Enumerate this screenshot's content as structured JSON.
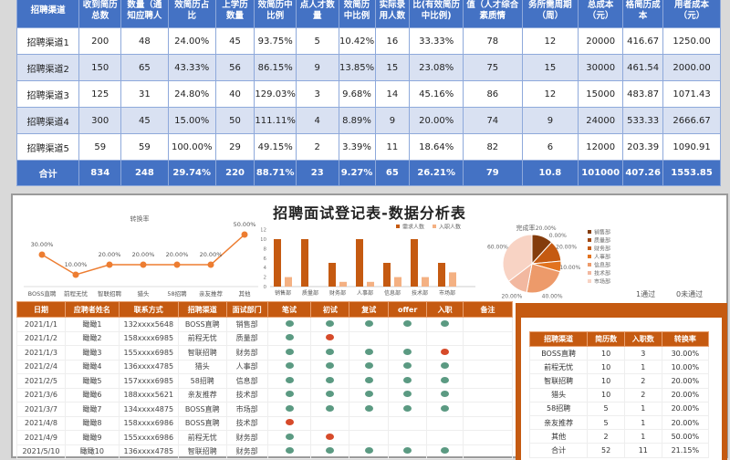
{
  "top_table": {
    "headers": [
      "招聘渠道",
      "收到简历总数",
      "数量（通知应聘人",
      "效简历占比",
      "上学历数量",
      "效简历中比例",
      "点人才数量",
      "效简历中比例",
      "实际录用人数",
      "比(有效简历中比例)",
      "值（人才综合素质情",
      "务所需周期（周）",
      "总成本（元）",
      "格简历成本",
      "用者成本（元）"
    ],
    "rows": [
      [
        "招聘渠道1",
        "200",
        "48",
        "24.00%",
        "45",
        "93.75%",
        "5",
        "10.42%",
        "16",
        "33.33%",
        "78",
        "12",
        "20000",
        "416.67",
        "1250.00"
      ],
      [
        "招聘渠道2",
        "150",
        "65",
        "43.33%",
        "56",
        "86.15%",
        "9",
        "13.85%",
        "15",
        "23.08%",
        "75",
        "15",
        "30000",
        "461.54",
        "2000.00"
      ],
      [
        "招聘渠道3",
        "125",
        "31",
        "24.80%",
        "40",
        "129.03%",
        "3",
        "9.68%",
        "14",
        "45.16%",
        "86",
        "12",
        "15000",
        "483.87",
        "1071.43"
      ],
      [
        "招聘渠道4",
        "300",
        "45",
        "15.00%",
        "50",
        "111.11%",
        "4",
        "8.89%",
        "9",
        "20.00%",
        "74",
        "9",
        "24000",
        "533.33",
        "2666.67"
      ],
      [
        "招聘渠道5",
        "59",
        "59",
        "100.00%",
        "29",
        "49.15%",
        "2",
        "3.39%",
        "11",
        "18.64%",
        "82",
        "6",
        "12000",
        "203.39",
        "1090.91"
      ]
    ],
    "total": [
      "合计",
      "834",
      "248",
      "29.74%",
      "220",
      "88.71%",
      "23",
      "9.27%",
      "65",
      "26.21%",
      "79",
      "10.8",
      "101000",
      "407.26",
      "1553.85"
    ]
  },
  "dashboard_title": "招聘面试登记表-数据分析表",
  "chart_data": [
    {
      "type": "line",
      "title": "转换率",
      "categories": [
        "BOSS直聘",
        "前程无忧",
        "智联招聘",
        "猎头",
        "58招聘",
        "亲友推荐",
        "其他"
      ],
      "values": [
        30,
        10,
        20,
        20,
        20,
        20,
        50
      ],
      "data_labels": [
        "30.00%",
        "10.00%",
        "20.00%",
        "20.00%",
        "20.00%",
        "20.00%",
        "50.00%"
      ],
      "color": "#ed7d31"
    },
    {
      "type": "bar",
      "categories": [
        "销售部",
        "质量部",
        "财务部",
        "人事部",
        "信息部",
        "技术部",
        "市场部"
      ],
      "ylim": [
        0,
        12
      ],
      "yticks": [
        "0",
        "2",
        "4",
        "6",
        "8",
        "10",
        "12"
      ],
      "legend": "top-right",
      "series": [
        {
          "name": "需求人数",
          "values": [
            10,
            10,
            5,
            10,
            5,
            10,
            5
          ],
          "color": "#c55a11"
        },
        {
          "name": "入职人数",
          "values": [
            2,
            0,
            1,
            1,
            2,
            2,
            3
          ],
          "color": "#f4b183"
        }
      ]
    },
    {
      "type": "pie",
      "title": "完成率",
      "categories": [
        "销售部",
        "质量部",
        "财务部",
        "人事部",
        "信息部",
        "技术部",
        "市场部"
      ],
      "values": [
        20,
        0,
        20,
        10,
        40,
        20,
        60
      ],
      "data_labels": [
        "20.00%",
        "0.00%",
        "20.00%",
        "10.00%",
        "40.00%",
        "20.00%",
        "60.00%"
      ],
      "colors": [
        "#843c0c",
        "#a0460f",
        "#c55a11",
        "#e2731f",
        "#ed9a6a",
        "#f2b8a0",
        "#f8d3c4"
      ],
      "legend": "right"
    }
  ],
  "pass_legend": {
    "pass": "1通过",
    "fail": "0未通过"
  },
  "colors": {
    "pass": "#5b9a82",
    "fail": "#d64a2a",
    "accent": "#c55a11",
    "blue": "#4472c4"
  },
  "log_table": {
    "headers": [
      "日期",
      "应聘者姓名",
      "联系方式",
      "招聘渠道",
      "面试部门",
      "笔试",
      "初试",
      "复试",
      "offer",
      "入职",
      "备注"
    ],
    "rows": [
      {
        "date": "2021/1/1",
        "name": "瞰瞰1",
        "phone": "132xxxx5648",
        "channel": "BOSS直聘",
        "dept": "销售部",
        "status": [
          1,
          1,
          1,
          1,
          1
        ],
        "note": ""
      },
      {
        "date": "2021/1/2",
        "name": "瞰瞰2",
        "phone": "158xxxx6985",
        "channel": "前程无忧",
        "dept": "质量部",
        "status": [
          1,
          0,
          null,
          null,
          null
        ],
        "note": ""
      },
      {
        "date": "2021/1/3",
        "name": "瞰瞰3",
        "phone": "155xxxx6985",
        "channel": "智联招聘",
        "dept": "财务部",
        "status": [
          1,
          1,
          1,
          1,
          0
        ],
        "note": ""
      },
      {
        "date": "2021/2/4",
        "name": "瞰瞰4",
        "phone": "136xxxx4785",
        "channel": "猎头",
        "dept": "人事部",
        "status": [
          1,
          1,
          1,
          1,
          1
        ],
        "note": ""
      },
      {
        "date": "2021/2/5",
        "name": "瞰瞰5",
        "phone": "157xxxx6985",
        "channel": "58招聘",
        "dept": "信息部",
        "status": [
          1,
          1,
          1,
          1,
          1
        ],
        "note": ""
      },
      {
        "date": "2021/3/6",
        "name": "瞰瞰6",
        "phone": "188xxxx5621",
        "channel": "亲友推荐",
        "dept": "技术部",
        "status": [
          1,
          1,
          1,
          1,
          1
        ],
        "note": ""
      },
      {
        "date": "2021/3/7",
        "name": "瞰瞰7",
        "phone": "134xxxx4875",
        "channel": "BOSS直聘",
        "dept": "市场部",
        "status": [
          1,
          1,
          1,
          1,
          1
        ],
        "note": ""
      },
      {
        "date": "2021/4/8",
        "name": "瞰瞰8",
        "phone": "158xxxx6986",
        "channel": "BOSS直聘",
        "dept": "技术部",
        "status": [
          0,
          null,
          null,
          null,
          null
        ],
        "note": ""
      },
      {
        "date": "2021/4/9",
        "name": "瞰瞰9",
        "phone": "155xxxx6986",
        "channel": "前程无忧",
        "dept": "财务部",
        "status": [
          1,
          0,
          null,
          null,
          null
        ],
        "note": ""
      },
      {
        "date": "2021/5/10",
        "name": "瞰瞰10",
        "phone": "136xxxx4785",
        "channel": "智联招聘",
        "dept": "财务部",
        "status": [
          1,
          1,
          1,
          1,
          1
        ],
        "note": ""
      }
    ]
  },
  "summary_table": {
    "headers": [
      "招聘渠道",
      "简历数",
      "入职数",
      "转换率"
    ],
    "rows": [
      [
        "BOSS直聘",
        "10",
        "3",
        "30.00%"
      ],
      [
        "前程无忧",
        "10",
        "1",
        "10.00%"
      ],
      [
        "智联招聘",
        "10",
        "2",
        "20.00%"
      ],
      [
        "猎头",
        "10",
        "2",
        "20.00%"
      ],
      [
        "58招聘",
        "5",
        "1",
        "20.00%"
      ],
      [
        "亲友推荐",
        "5",
        "1",
        "20.00%"
      ],
      [
        "其他",
        "2",
        "1",
        "50.00%"
      ],
      [
        "合计",
        "52",
        "11",
        "21.15%"
      ]
    ]
  }
}
